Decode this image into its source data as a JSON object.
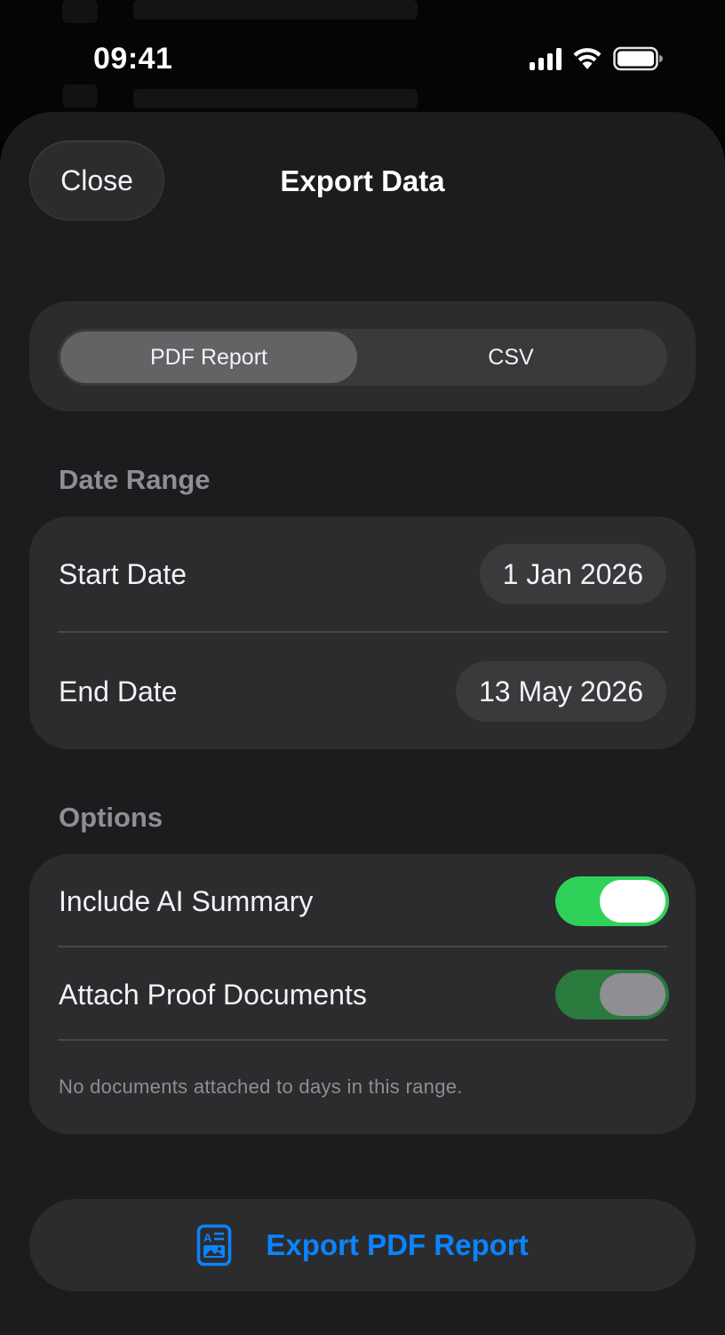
{
  "status_bar": {
    "time": "09:41"
  },
  "sheet": {
    "close_label": "Close",
    "title": "Export Data"
  },
  "format": {
    "options": [
      "PDF Report",
      "CSV"
    ],
    "selected": "PDF Report"
  },
  "date_range": {
    "heading": "Date Range",
    "start_label": "Start Date",
    "start_value": "1 Jan 2026",
    "end_label": "End Date",
    "end_value": "13 May 2026"
  },
  "options": {
    "heading": "Options",
    "ai_summary_label": "Include AI Summary",
    "ai_summary_on": true,
    "proof_docs_label": "Attach Proof Documents",
    "proof_docs_on": true,
    "proof_docs_enabled": false,
    "footnote": "No documents attached to days in this range."
  },
  "export_button": {
    "label": "Export PDF Report",
    "icon": "document-text-image-icon"
  },
  "colors": {
    "accent": "#0a84ff",
    "toggle_on": "#30d158",
    "sheet_background": "#1c1c1e",
    "card_background": "#2c2c2e"
  }
}
